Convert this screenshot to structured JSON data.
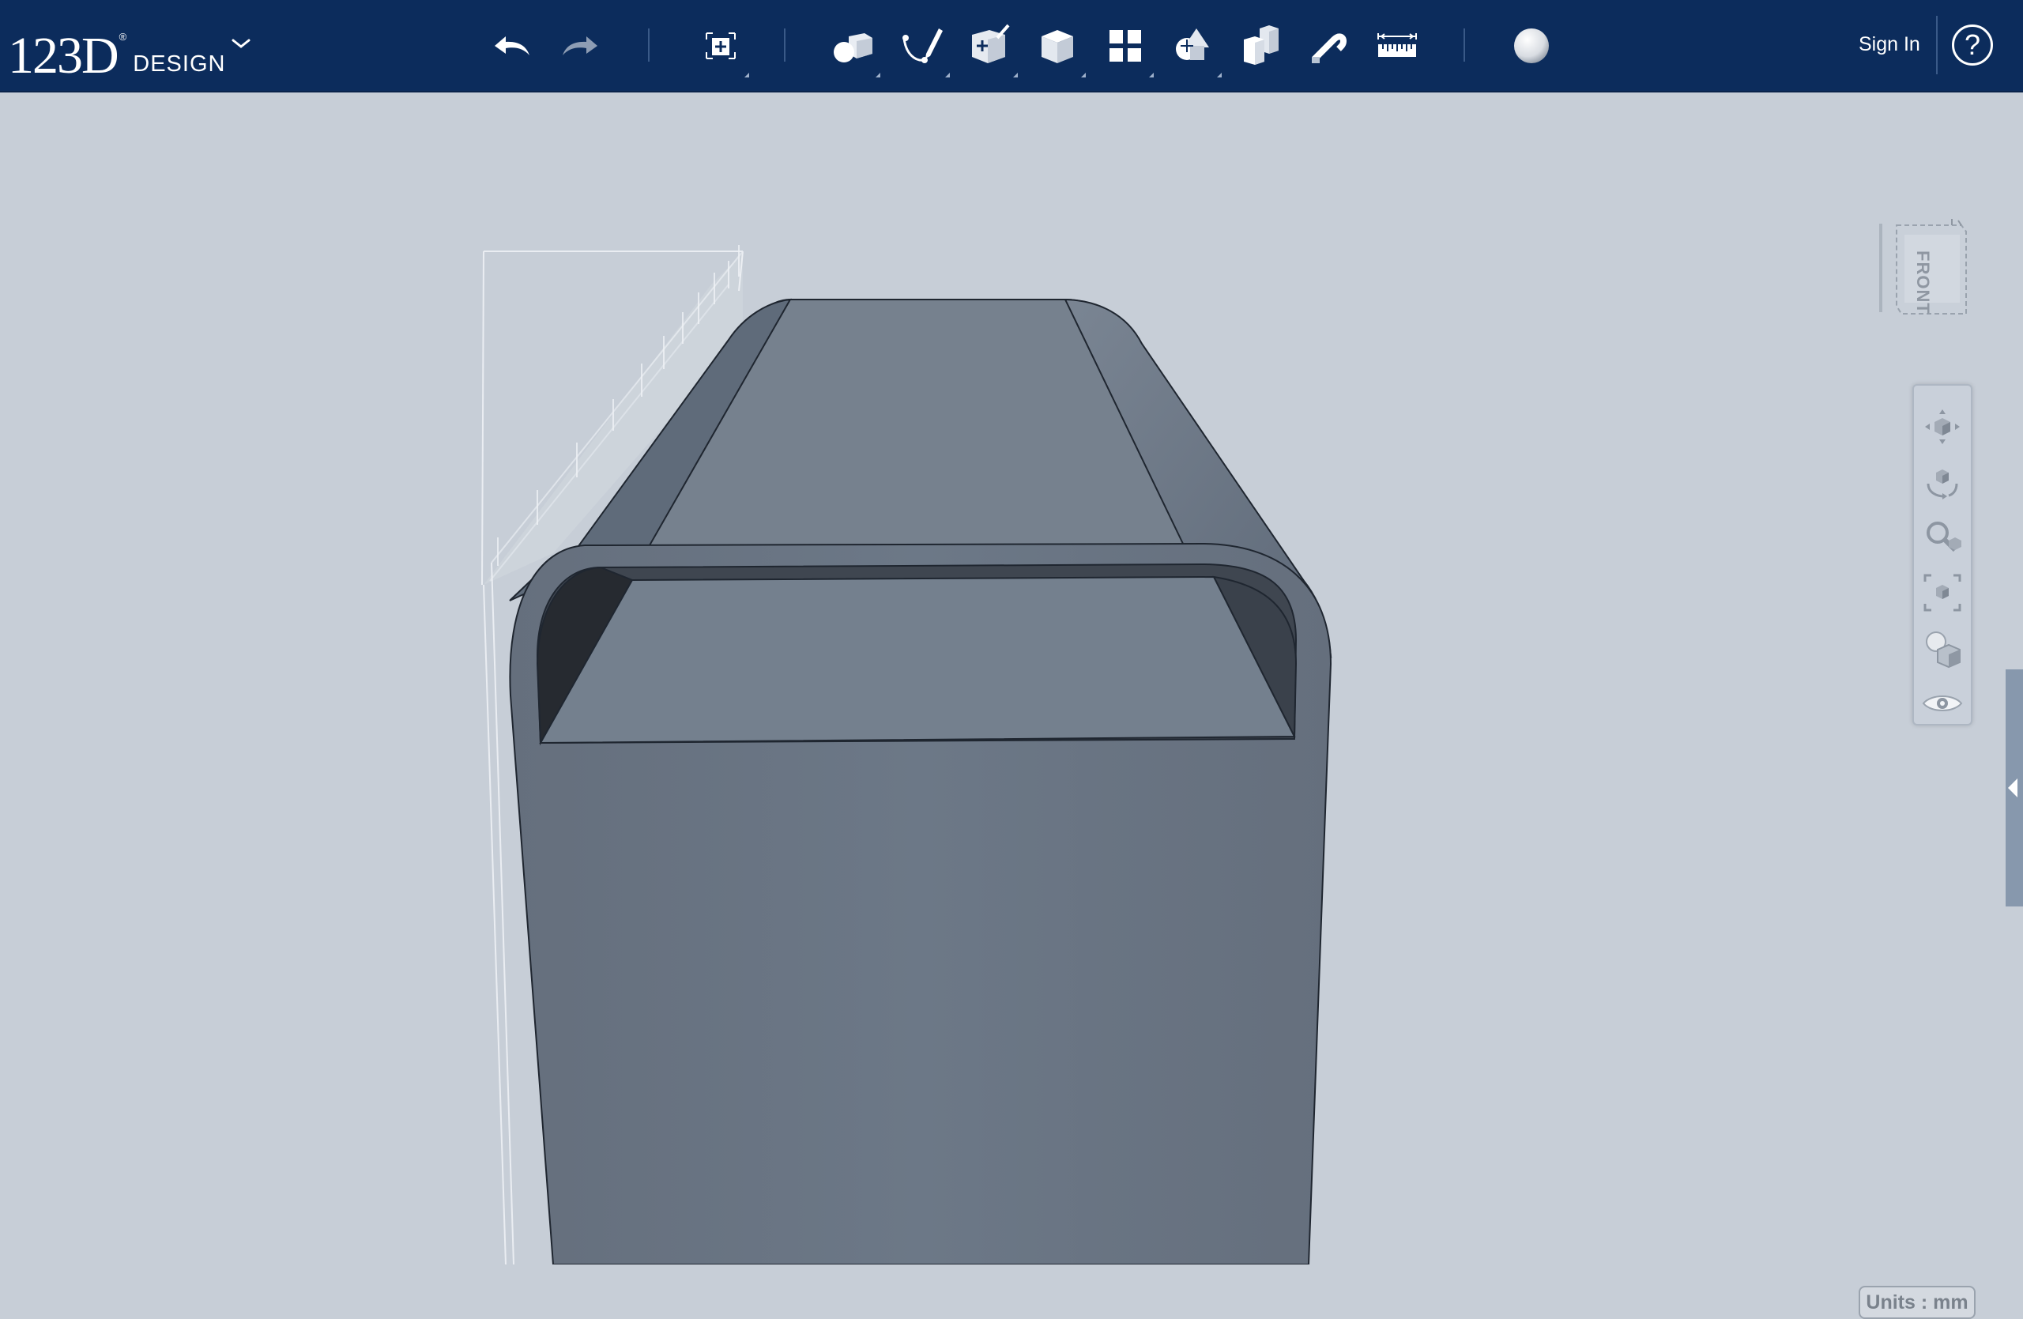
{
  "app": {
    "logo_number": "123D",
    "logo_registered": "®",
    "logo_word": "DESIGN"
  },
  "toolbar": {
    "items": [
      {
        "name": "undo",
        "icon": "undo-icon"
      },
      {
        "name": "redo",
        "icon": "redo-icon"
      },
      {
        "name": "transform",
        "icon": "transform-icon"
      },
      {
        "name": "primitives",
        "icon": "primitives-icon"
      },
      {
        "name": "sketch",
        "icon": "sketch-icon"
      },
      {
        "name": "construct",
        "icon": "construct-icon"
      },
      {
        "name": "modify",
        "icon": "modify-icon"
      },
      {
        "name": "pattern",
        "icon": "pattern-icon"
      },
      {
        "name": "grouping",
        "icon": "grouping-icon"
      },
      {
        "name": "combine",
        "icon": "combine-icon"
      },
      {
        "name": "snap",
        "icon": "snap-icon"
      },
      {
        "name": "measure",
        "icon": "measure-icon"
      },
      {
        "name": "material",
        "icon": "material-icon"
      }
    ],
    "sign_in": "Sign In",
    "help": "?"
  },
  "viewcube": {
    "label": "FRONT"
  },
  "navbar": {
    "items": [
      {
        "name": "pan",
        "icon": "pan-icon"
      },
      {
        "name": "orbit",
        "icon": "orbit-icon"
      },
      {
        "name": "zoom",
        "icon": "zoom-icon"
      },
      {
        "name": "fit",
        "icon": "fit-icon"
      },
      {
        "name": "view-mode",
        "icon": "view-mode-icon"
      },
      {
        "name": "visibility",
        "icon": "eye-icon"
      }
    ]
  },
  "status": {
    "units": "Units : mm"
  },
  "colors": {
    "toolbar_bg": "#0c2c5c",
    "viewport_bg": "#c7ced7",
    "model_face": "#6a7686",
    "model_top": "#76828f"
  }
}
